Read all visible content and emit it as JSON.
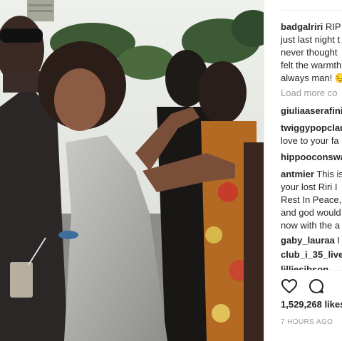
{
  "post": {
    "caption_user": "badgalriri",
    "caption_lines": [
      "RIP",
      "just last night t",
      "never thought",
      "felt the warmth",
      "always man! 😔"
    ]
  },
  "load_more": "Load more co",
  "comments": [
    {
      "user": "giuliaaserafini_",
      "text": ""
    },
    {
      "user": "twiggypopclau",
      "text": ""
    },
    {
      "user": "",
      "text": "love to your fa"
    },
    {
      "user": "hippooconswa",
      "text": ""
    },
    {
      "user": "antmier",
      "text": "This is"
    },
    {
      "user": "",
      "text": "your lost Riri I"
    },
    {
      "user": "",
      "text": "Rest In Peace, I"
    },
    {
      "user": "",
      "text": "and god would"
    },
    {
      "user": "",
      "text": "now with the a"
    },
    {
      "user": "gaby_lauraa",
      "text": "I"
    },
    {
      "user": "club_i_35_live",
      "text": ""
    },
    {
      "user": "lilliesibson",
      "text": ""
    }
  ],
  "icons": {
    "like": "heart-icon",
    "comment": "comment-bubble-icon"
  },
  "likes": "1,529,268 likes",
  "timestamp": "7 HOURS AGO"
}
